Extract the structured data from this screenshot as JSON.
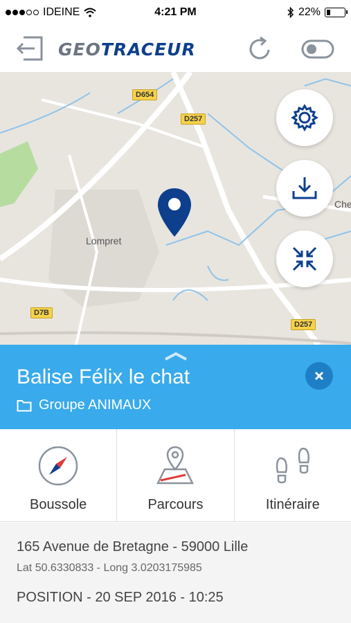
{
  "status_bar": {
    "carrier": "IDEINE",
    "time": "4:21 PM",
    "battery": "22%",
    "battery_level": 0.22,
    "signal_bars_filled": 3,
    "signal_bars_total": 5
  },
  "header": {
    "logo_prefix": "GEO",
    "logo_suffix": "TRACEUR",
    "icons": [
      "back-arrow-icon",
      "refresh-icon",
      "toggle-icon"
    ]
  },
  "map": {
    "road_labels": [
      "D654",
      "D257",
      "D257",
      "D7B"
    ],
    "place_labels": [
      "Lompret",
      "Che"
    ]
  },
  "beacon": {
    "title": "Balise Félix le chat",
    "group": "Groupe ANIMAUX"
  },
  "actions": [
    {
      "label": "Boussole",
      "icon": "compass-icon"
    },
    {
      "label": "Parcours",
      "icon": "route-map-icon"
    },
    {
      "label": "Itinéraire",
      "icon": "footsteps-icon"
    }
  ],
  "address": {
    "street": "165 Avenue de Bretagne - 59000 Lille",
    "coordinates": "Lat 50.6330833 - Long 3.0203175985",
    "position": "POSITION - 20 SEP 2016 - 10:25"
  },
  "colors": {
    "brand_blue": "#0d3f8c",
    "panel_blue": "#39aaeb",
    "close_blue": "#1f7fc6",
    "compass_red": "#e03a3a"
  }
}
